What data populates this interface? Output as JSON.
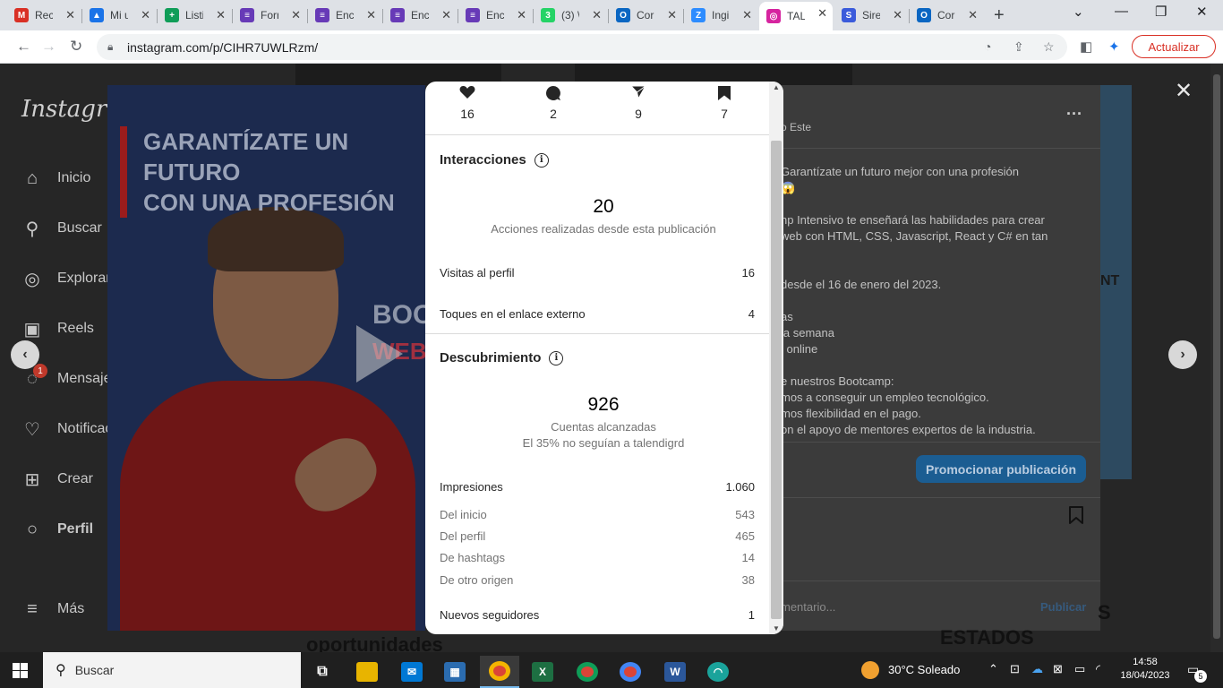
{
  "browser": {
    "tabs": [
      {
        "label": "Rec",
        "icon": "gmail-icon",
        "color": "#d93025",
        "glyph": "M"
      },
      {
        "label": "Mi u",
        "icon": "drive-icon",
        "color": "#1a73e8",
        "glyph": "▲"
      },
      {
        "label": "Listi",
        "icon": "sheets-icon",
        "color": "#0f9d58",
        "glyph": "+"
      },
      {
        "label": "Forr",
        "icon": "forms-icon",
        "color": "#673ab7",
        "glyph": "≡"
      },
      {
        "label": "Enc",
        "icon": "forms-icon",
        "color": "#673ab7",
        "glyph": "≡"
      },
      {
        "label": "Enc",
        "icon": "forms-icon",
        "color": "#673ab7",
        "glyph": "≡"
      },
      {
        "label": "Enc",
        "icon": "forms-icon",
        "color": "#673ab7",
        "glyph": "≡"
      },
      {
        "label": "(3) \\",
        "icon": "whatsapp-icon",
        "color": "#25d366",
        "glyph": "3"
      },
      {
        "label": "Cor",
        "icon": "outlook-icon",
        "color": "#0a66c2",
        "glyph": "O"
      },
      {
        "label": "Ingi",
        "icon": "zoom-icon",
        "color": "#2d8cff",
        "glyph": "Z"
      },
      {
        "label": "TAL",
        "icon": "instagram-icon",
        "color": "#d6249f",
        "glyph": "◎",
        "active": true
      },
      {
        "label": "Sire",
        "icon": "sire-icon",
        "color": "#3b5bdb",
        "glyph": "S"
      },
      {
        "label": "Cor",
        "icon": "outlook-icon",
        "color": "#0a66c2",
        "glyph": "O"
      }
    ],
    "url": "instagram.com/p/CIHR7UWLRzm/",
    "update_label": "Actualizar"
  },
  "sidebar": {
    "logo": "Instagram",
    "items": [
      {
        "label": "Inicio",
        "icon": "home-icon",
        "glyph": "⌂"
      },
      {
        "label": "Buscar",
        "icon": "search-icon",
        "glyph": "⚲"
      },
      {
        "label": "Explorar",
        "icon": "compass-icon",
        "glyph": "◎"
      },
      {
        "label": "Reels",
        "icon": "reels-icon",
        "glyph": "▣"
      },
      {
        "label": "Mensajes",
        "icon": "messenger-icon",
        "glyph": "◌"
      },
      {
        "label": "Notificaciones",
        "icon": "heart-icon",
        "glyph": "♡"
      },
      {
        "label": "Crear",
        "icon": "create-icon",
        "glyph": "⊞"
      },
      {
        "label": "Perfil",
        "icon": "profile-avatar-icon",
        "glyph": "○"
      },
      {
        "label": "Más",
        "icon": "menu-icon",
        "glyph": "≡"
      }
    ],
    "messages_badge": "1"
  },
  "post": {
    "media": {
      "headline_1": "GARANTÍZATE UN FUTURO",
      "headline_2": "CON UNA PROFESIÓN",
      "boot_text": "BOOT",
      "web_text": "WEB"
    },
    "author_fragment": "o Este",
    "caption_lines": [
      "Garantízate un futuro mejor con una profesión",
      "😱",
      "",
      "np Intensivo te enseñará las habilidades para crear",
      " web con HTML, CSS, Javascript, React y C# en tan",
      ".",
      "",
      "desde el 16 de enero del 2023.",
      "",
      "as",
      " la semana",
      "l online",
      "",
      "e nuestros Bootcamp:",
      "mos a conseguir un empleo tecnológico.",
      "mos flexibilidad en el pago.",
      "on el apoyo de mentores expertos de la industria."
    ],
    "promote_label": "Promocionar publicación",
    "comment_placeholder": "mentario...",
    "publish_label": "Publicar",
    "bg_fragments": {
      "right_nt": "NT",
      "bottom_left_1": "oportunidades",
      "bottom_right": "ESTADOS",
      "bottom_right_small": "S"
    }
  },
  "insights": {
    "stats": [
      {
        "icon": "heart-icon",
        "value": "16"
      },
      {
        "icon": "comment-icon",
        "value": "2"
      },
      {
        "icon": "share-icon",
        "value": "9"
      },
      {
        "icon": "bookmark-icon",
        "value": "7"
      }
    ],
    "interactions": {
      "title": "Interacciones",
      "total": "20",
      "total_label": "Acciones realizadas desde esta publicación",
      "rows": [
        {
          "label": "Visitas al perfil",
          "value": "16"
        },
        {
          "label": "Toques en el enlace externo",
          "value": "4"
        }
      ]
    },
    "discovery": {
      "title": "Descubrimiento",
      "total": "926",
      "total_label": "Cuentas alcanzadas",
      "followers_note": "El 35% no seguían a talendigrd",
      "impressions": {
        "label": "Impresiones",
        "value": "1.060"
      },
      "breakdown": [
        {
          "label": "Del inicio",
          "value": "543"
        },
        {
          "label": "Del perfil",
          "value": "465"
        },
        {
          "label": "De hashtags",
          "value": "14"
        },
        {
          "label": "De otro origen",
          "value": "38"
        }
      ],
      "new_followers": {
        "label": "Nuevos seguidores",
        "value": "1"
      }
    }
  },
  "taskbar": {
    "search_label": "Buscar",
    "weather": "30°C  Soleado",
    "time": "14:58",
    "date": "18/04/2023",
    "notifications_count": "5"
  }
}
